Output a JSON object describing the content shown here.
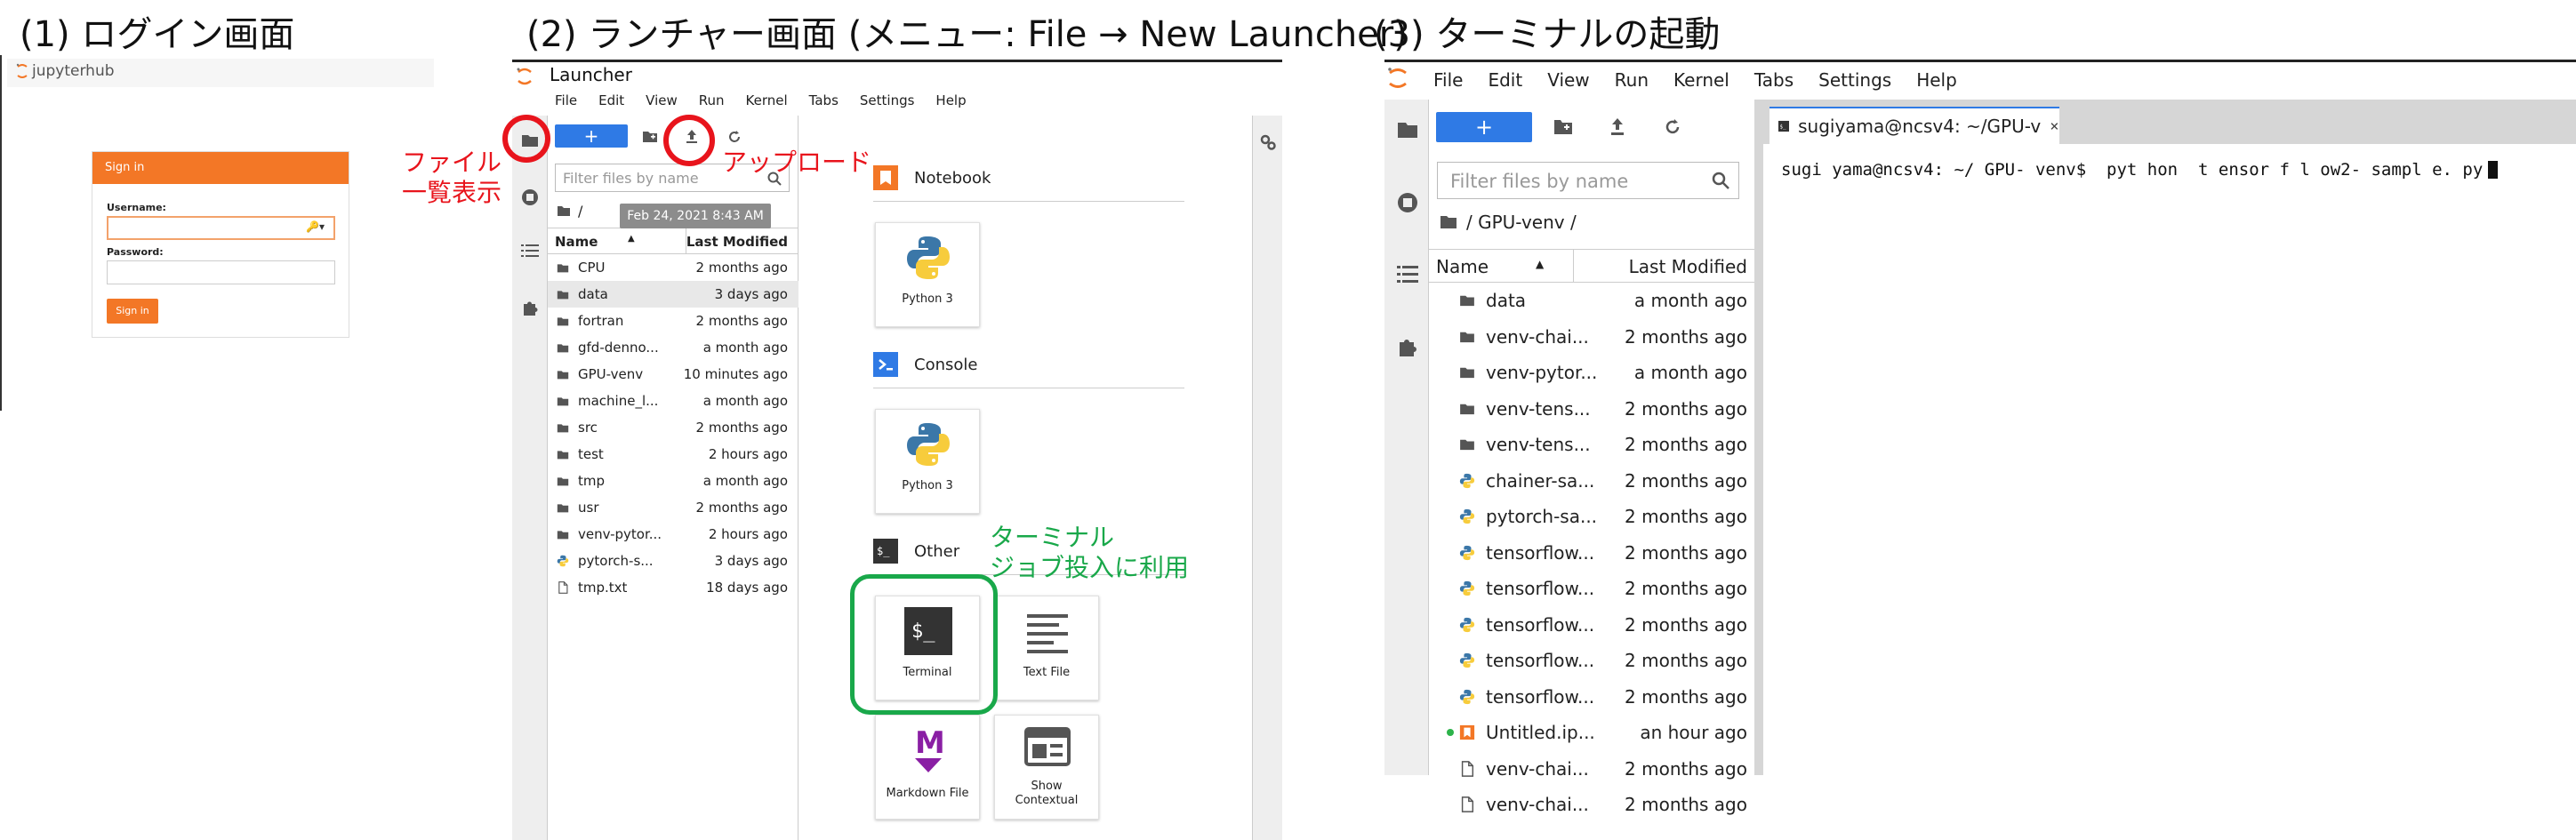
{
  "panel1": {
    "heading": "(1) ログイン画面",
    "logo_text": "jupyterhub",
    "signin_header": "Sign in",
    "username_label": "Username:",
    "password_label": "Password:",
    "signin_button": "Sign in",
    "brand_color": "#f37726"
  },
  "panel2": {
    "heading": "(2) ランチャー画面 (メニュー: File → New Launcher)",
    "window_title": "Launcher",
    "menu": [
      "File",
      "Edit",
      "View",
      "Run",
      "Kernel",
      "Tabs",
      "Settings",
      "Help"
    ],
    "new_button": "+",
    "filter_placeholder": "Filter files by name",
    "path": "/",
    "tooltip": "Feb 24, 2021 8:43 AM",
    "col_name": "Name",
    "col_modified": "Last Modified",
    "files": [
      {
        "name": "CPU",
        "modified": "2 months ago",
        "icon": "folder-icon"
      },
      {
        "name": "data",
        "modified": "3 days ago",
        "icon": "folder-icon"
      },
      {
        "name": "fortran",
        "modified": "2 months ago",
        "icon": "folder-icon"
      },
      {
        "name": "gfd-denno...",
        "modified": "a month ago",
        "icon": "folder-icon"
      },
      {
        "name": "GPU-venv",
        "modified": "10 minutes ago",
        "icon": "folder-icon"
      },
      {
        "name": "machine_l...",
        "modified": "a month ago",
        "icon": "folder-icon"
      },
      {
        "name": "src",
        "modified": "2 months ago",
        "icon": "folder-icon"
      },
      {
        "name": "test",
        "modified": "2 hours ago",
        "icon": "folder-icon"
      },
      {
        "name": "tmp",
        "modified": "a month ago",
        "icon": "folder-icon"
      },
      {
        "name": "usr",
        "modified": "2 months ago",
        "icon": "folder-icon"
      },
      {
        "name": "venv-pytor...",
        "modified": "2 hours ago",
        "icon": "folder-icon"
      },
      {
        "name": "pytorch-s...",
        "modified": "3 days ago",
        "icon": "python-icon"
      },
      {
        "name": "tmp.txt",
        "modified": "18 days ago",
        "icon": "file-icon"
      }
    ],
    "sections": {
      "notebook": "Notebook",
      "console": "Console",
      "other": "Other"
    },
    "cards": {
      "python3_notebook": "Python 3",
      "python3_console": "Python 3",
      "terminal": "Terminal",
      "text_file": "Text File",
      "markdown_file": "Markdown File",
      "show_contextual_1": "Show",
      "show_contextual_2": "Contextual"
    },
    "annotations": {
      "file_list_1": "ファイル",
      "file_list_2": "一覧表示",
      "upload": "アップロード",
      "terminal_1": "ターミナル",
      "terminal_2": "ジョブ投入に利用"
    },
    "annotation_red": "#e8141c",
    "annotation_green": "#19a84a",
    "accent": "#2f7ae5"
  },
  "panel3": {
    "heading": "(3) ターミナルの起動",
    "menu": [
      "File",
      "Edit",
      "View",
      "Run",
      "Kernel",
      "Tabs",
      "Settings",
      "Help"
    ],
    "new_button": "+",
    "filter_placeholder": "Filter files by name",
    "path": "/ GPU-venv /",
    "col_name": "Name",
    "col_modified": "Last Modified",
    "files": [
      {
        "name": "data",
        "modified": "a month ago",
        "icon": "folder-icon"
      },
      {
        "name": "venv-chai...",
        "modified": "2 months ago",
        "icon": "folder-icon"
      },
      {
        "name": "venv-pytor...",
        "modified": "a month ago",
        "icon": "folder-icon"
      },
      {
        "name": "venv-tens...",
        "modified": "2 months ago",
        "icon": "folder-icon"
      },
      {
        "name": "venv-tens...",
        "modified": "2 months ago",
        "icon": "folder-icon"
      },
      {
        "name": "chainer-sa...",
        "modified": "2 months ago",
        "icon": "python-icon"
      },
      {
        "name": "pytorch-sa...",
        "modified": "2 months ago",
        "icon": "python-icon"
      },
      {
        "name": "tensorflow...",
        "modified": "2 months ago",
        "icon": "python-icon"
      },
      {
        "name": "tensorflow...",
        "modified": "2 months ago",
        "icon": "python-icon"
      },
      {
        "name": "tensorflow...",
        "modified": "2 months ago",
        "icon": "python-icon"
      },
      {
        "name": "tensorflow...",
        "modified": "2 months ago",
        "icon": "python-icon"
      },
      {
        "name": "tensorflow...",
        "modified": "2 months ago",
        "icon": "python-icon"
      },
      {
        "name": "Untitled.ip...",
        "modified": "an hour ago",
        "icon": "notebook-icon"
      },
      {
        "name": "venv-chai...",
        "modified": "2 months ago",
        "icon": "file-icon"
      },
      {
        "name": "venv-chai...",
        "modified": "2 months ago",
        "icon": "file-icon"
      }
    ],
    "tab_title": "sugiyama@ncsv4: ~/GPU-v",
    "terminal_line": "sugi yama@ncsv4: ~/ GPU- venv$  pyt hon  t ensor f l ow2- sampl e. py"
  }
}
